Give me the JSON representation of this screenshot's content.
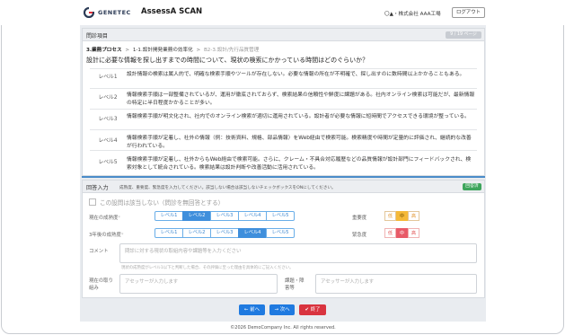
{
  "header": {
    "logo_text": "GENETEC",
    "app_title": "AssessA SCAN",
    "company": "〇▲・株式会社 AAA工場",
    "logout_label": "ログアウト"
  },
  "question": {
    "panel_title": "問診項目",
    "page_badge": "9 / 19 ページ",
    "breadcrumb": {
      "process": "3.業務プロセス",
      "sep1": ">",
      "sub": "1-1.設計開発業務の効率化",
      "sep2": ">",
      "item": "B2-3.設計/先行品質管理"
    },
    "text": "設計に必要な情報を探し出すまでの時間について、現状の検索にかかっている時間はどのぐらいか？",
    "levels": [
      {
        "label": "レベル1",
        "desc": "設計情報の検索は属人的で、明確な検索手順やツールが存在しない。必要な情報の所在が不明確で、探し出すのに数時間以上かかることもある。"
      },
      {
        "label": "レベル2",
        "desc": "情報検索手順は一部整備されているが、運用が徹底されておらず、検索結果の信頼性や鮮度に課題がある。社内オンライン検索は可能だが、最新情報の特定に半日程度かかることが多い。"
      },
      {
        "label": "レベル3",
        "desc": "情報検索手順が明文化され、社内でのオンライン検索が適切に運用されている。設計者が必要な情報に短時間でアクセスできる環境が整っている。"
      },
      {
        "label": "レベル4",
        "desc": "情報検索手順が定着し、社外の情報（例：技術資料、規格、部品情報）をWeb経由で検索可能。検索精度や時間が定量的に評価され、継続的な改善が行われている。"
      },
      {
        "label": "レベル5",
        "desc": "情報検索手順が定着し、社外からもWeb経由で検索可能。さらに、クレーム・不具合対応履歴などの品質情報が設計部門にフィードバックされ、検索対象として統合されている。検索結果は設計判断や改善活動に活用されている。"
      }
    ]
  },
  "answer": {
    "title": "回答入力",
    "note": "成熟度、重要度、緊急度を入力してください。該当しない場合は該当しないチェックボックスをONにしてください。",
    "badge": "回答済",
    "na_label": "この設問は該当しない（問診を無回答とする）",
    "current_label": "現在の成熟度",
    "future_label": "3年後の成熟度",
    "required_mark": "*",
    "level_options": [
      "レベル1",
      "レベル2",
      "レベル3",
      "レベル4",
      "レベル5"
    ],
    "current_selected": "レベル2",
    "future_selected": "レベル4",
    "importance_label": "重要度",
    "urgency_label": "緊急度",
    "priority_options": [
      "低",
      "中",
      "高"
    ],
    "importance_selected": "中",
    "urgency_selected": "中",
    "comment_label": "コメント",
    "comment_placeholder": "問診に対する現状の取組内容や課題等を入力ください",
    "comment_hint": "現状の成熟度がレベル1以下と判断した場合、その評価に至った理由を具体的にご記入ください。",
    "initiative_label": "現在の取り組み",
    "initiative_placeholder": "アセッサーが入力します",
    "issue_label": "課題・障害等",
    "issue_placeholder": "アセッサーが入力します"
  },
  "nav": {
    "prev_label": "← 前へ",
    "next_label": "→ 次へ",
    "end_label": "✔ 終了"
  },
  "footer": {
    "copyright": "©2026 DemoCompany Inc. All rights reserved."
  },
  "colors": {
    "primary": "#1f7ae0",
    "level_active": "#3f8fdc",
    "importance_active": "#f5b938",
    "urgency_active": "#e85a67",
    "answered_badge": "#3ea55c",
    "end_button": "#d9343f"
  }
}
